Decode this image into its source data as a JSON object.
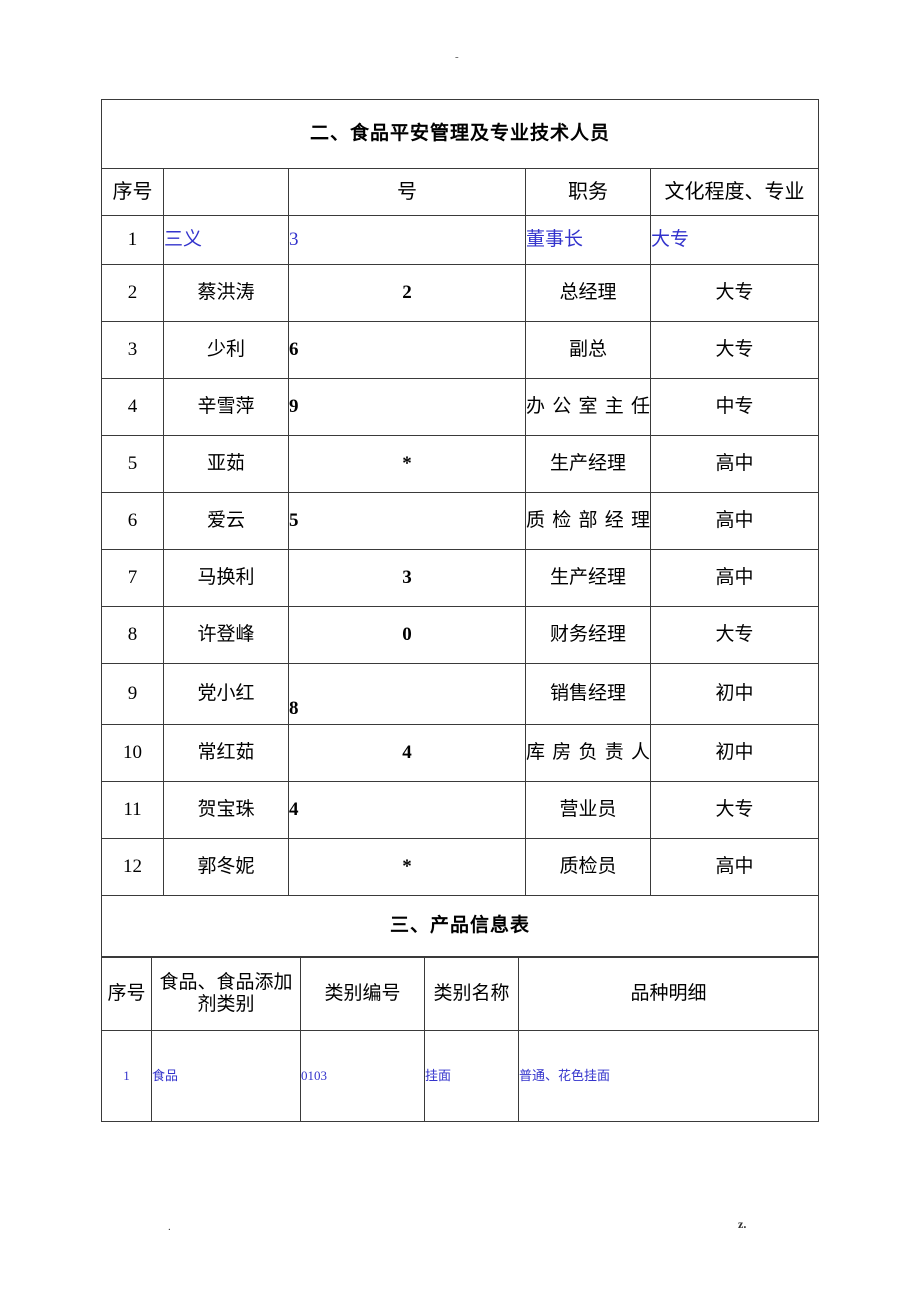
{
  "page": {
    "header_mark": "-",
    "footer_left": ".",
    "footer_right": "z."
  },
  "section_staff": {
    "title": "二、食品平安管理及专业技术人员",
    "columns": {
      "seq": "序号",
      "name": "",
      "number": "号",
      "position": "职务",
      "education": "文化程度、专业"
    },
    "rows": [
      {
        "seq": "1",
        "name": "三义",
        "number": "3",
        "position": "董事长",
        "education": "大专",
        "color": "#3333cc"
      },
      {
        "seq": "2",
        "name": "蔡洪涛",
        "number": "2",
        "position": "总经理",
        "education": "大专",
        "color": "#000000"
      },
      {
        "seq": "3",
        "name": "少利",
        "number": "6",
        "position": "副总",
        "education": "大专",
        "color": "#000000"
      },
      {
        "seq": "4",
        "name": "辛雪萍",
        "number": "9",
        "position": "办公室主任",
        "education": "中专",
        "color": "#000000"
      },
      {
        "seq": "5",
        "name": "亚茹",
        "number": "*",
        "position": "生产经理",
        "education": "高中",
        "color": "#000000"
      },
      {
        "seq": "6",
        "name": "爱云",
        "number": "5",
        "position": "质检部经理",
        "education": "高中",
        "color": "#000000"
      },
      {
        "seq": "7",
        "name": "马换利",
        "number": "3",
        "position": "生产经理",
        "education": "高中",
        "color": "#000000"
      },
      {
        "seq": "8",
        "name": "许登峰",
        "number": "0",
        "position": "财务经理",
        "education": "大专",
        "color": "#000000"
      },
      {
        "seq": "9",
        "name": "党小红",
        "number": "8",
        "position": "销售经理",
        "education": "初中",
        "color": "#000000"
      },
      {
        "seq": "10",
        "name": "常红茹",
        "number": "4",
        "position": "库房负责人",
        "education": "初中",
        "color": "#000000"
      },
      {
        "seq": "11",
        "name": "贺宝珠",
        "number": "4",
        "position": "营业员",
        "education": "大专",
        "color": "#000000"
      },
      {
        "seq": "12",
        "name": "郭冬妮",
        "number": "*",
        "position": "质检员",
        "education": "高中",
        "color": "#000000"
      }
    ]
  },
  "section_product": {
    "title": "三、产品信息表",
    "columns": {
      "seq": "序号",
      "category": "食品、食品添加剂类别",
      "code": "类别编号",
      "cat_name": "类别名称",
      "detail": "品种明细"
    },
    "rows": [
      {
        "seq": "1",
        "category": "食品",
        "code": "0103",
        "cat_name": "挂面",
        "detail": "普通、花色挂面",
        "color": "#3333cc"
      }
    ]
  }
}
